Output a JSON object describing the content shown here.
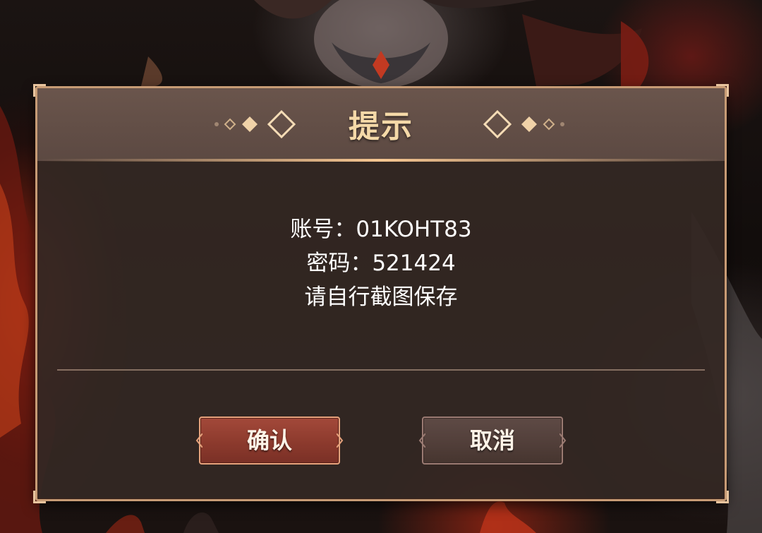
{
  "dialog": {
    "title": "提示",
    "lines": [
      "账号：01KOHT83",
      "密码：521424",
      "请自行截图保存"
    ],
    "confirm_label": "确认",
    "cancel_label": "取消"
  },
  "colors": {
    "title": "#f5d9a8",
    "frame": "#c79b75",
    "confirm_button": "#8c3a2d",
    "cancel_button": "#523f3a",
    "dialog_background": "#342824"
  },
  "icons": {
    "left_ornament": "diamond-ornament-icon",
    "right_ornament": "diamond-ornament-icon"
  }
}
